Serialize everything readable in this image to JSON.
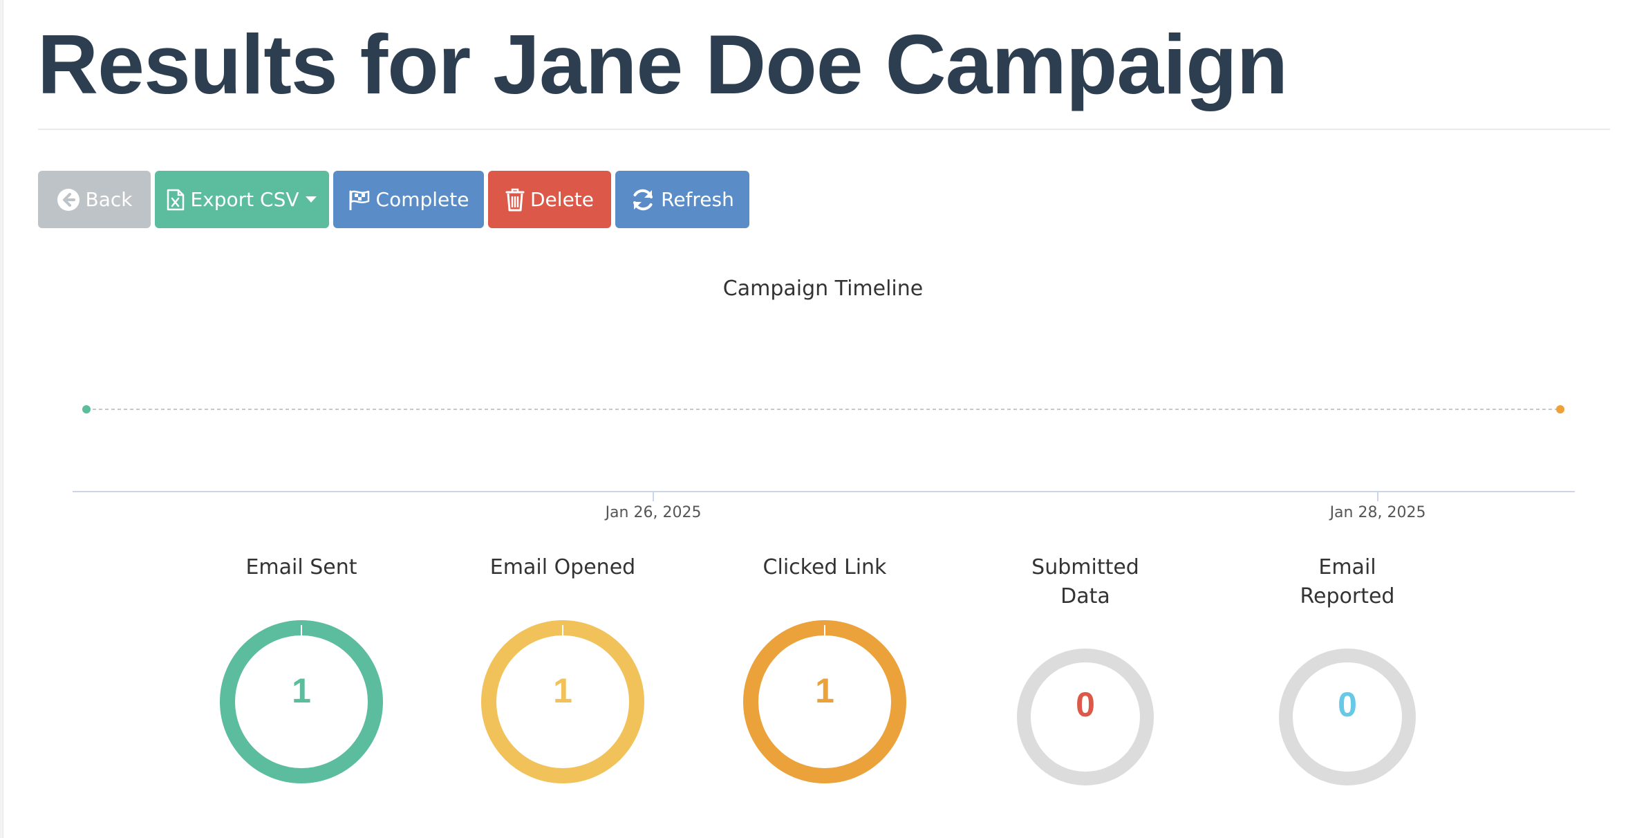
{
  "header": {
    "title": "Results for Jane Doe Campaign"
  },
  "toolbar": {
    "back_label": "Back",
    "export_label": "Export CSV",
    "complete_label": "Complete",
    "delete_label": "Delete",
    "refresh_label": "Refresh"
  },
  "timeline": {
    "title": "Campaign Timeline",
    "ticks": [
      "Jan 26, 2025",
      "Jan 28, 2025"
    ],
    "event_colors": [
      "#5bbd9d",
      "#f0a136"
    ]
  },
  "stats": [
    {
      "label": "Email Sent",
      "value": "1",
      "color": "#5bbd9d"
    },
    {
      "label": "Email Opened",
      "value": "1",
      "color": "#f2c25a"
    },
    {
      "label": "Clicked Link",
      "value": "1",
      "color": "#eba23a"
    },
    {
      "label": "Submitted Data",
      "value": "0",
      "color": "#dc5848"
    },
    {
      "label": "Email Reported",
      "value": "0",
      "color": "#67c9e6"
    }
  ],
  "icons": {
    "back": "arrow-circle-left-icon",
    "export": "file-excel-icon",
    "export_menu": "caret-down-icon",
    "complete": "flag-checkered-icon",
    "delete": "trash-icon",
    "refresh": "refresh-icon"
  }
}
